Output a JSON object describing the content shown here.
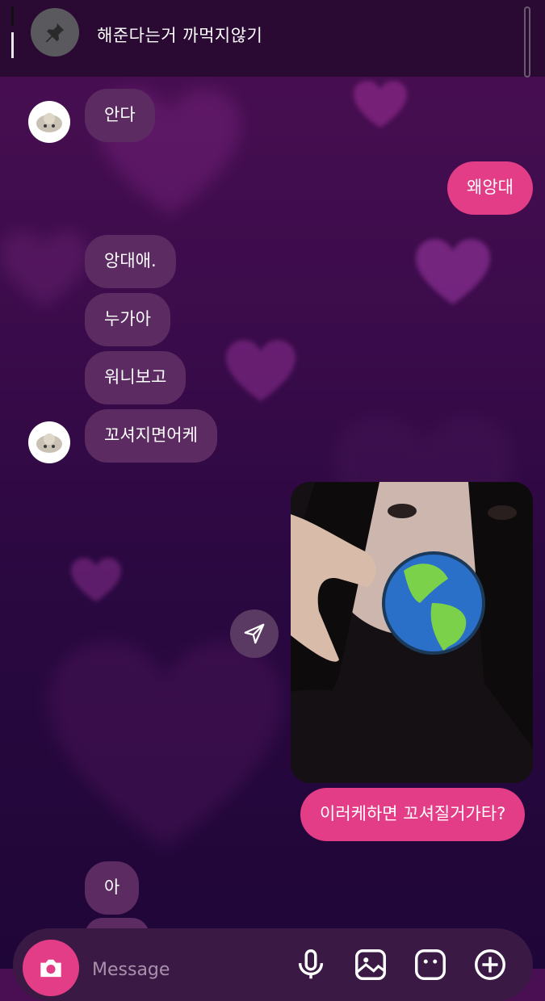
{
  "pinned": {
    "text": "해준다는거 까먹지않기",
    "icon": "pin-icon"
  },
  "messages": {
    "m1": "안다",
    "m2": "왜앙대",
    "m3": "앙대애.",
    "m4": "누가아",
    "m5": "워니보고",
    "m6": "꼬셔지면어케",
    "m7": "이러케하면 꼬셔질거가타?",
    "m8": "아"
  },
  "composer": {
    "placeholder": "Message"
  },
  "colors": {
    "sent": "#e23d86",
    "received": "#5b2b62",
    "background": "#3a0b4a"
  }
}
